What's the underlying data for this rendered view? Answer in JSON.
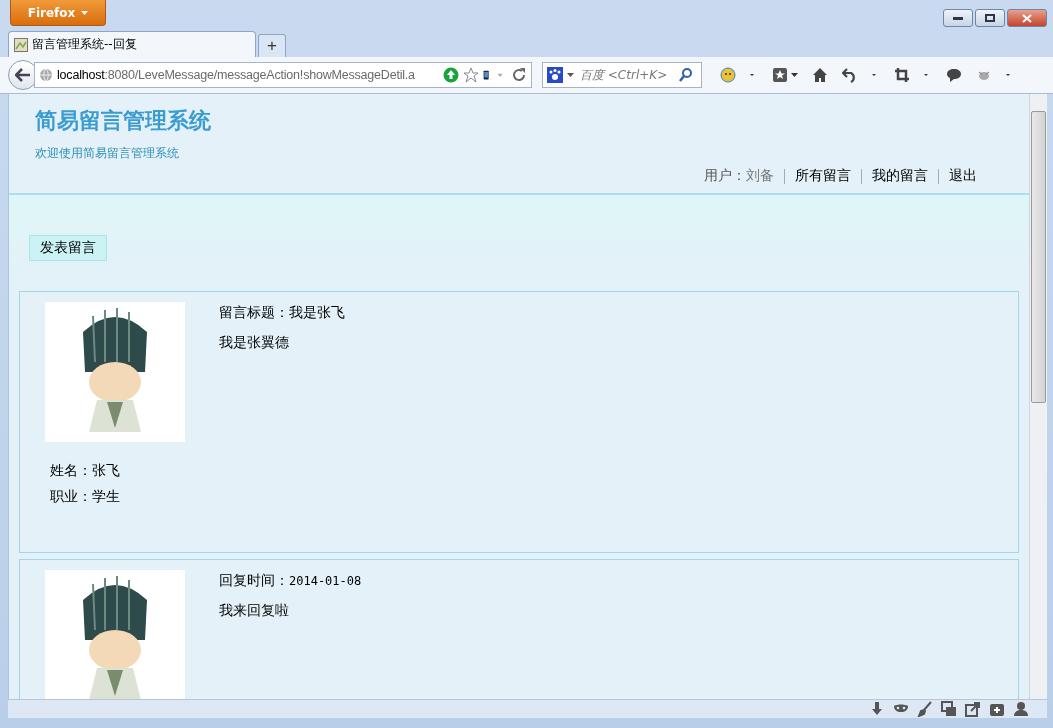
{
  "browser": {
    "app_button": "Firefox",
    "tabs": [
      {
        "title": "留言管理系统--回复",
        "selected": true
      }
    ],
    "new_tab": "+",
    "url_host": "localhost",
    "url_rest": ":8080/LeveMessage/messageAction!showMessageDetil.a",
    "search_placeholder": "百度 <Ctrl+K>"
  },
  "header": {
    "title": "简易留言管理系统",
    "subtitle": "欢迎使用简易留言管理系统",
    "user_label": "用户：",
    "user_name": "刘备",
    "links": [
      "所有留言",
      "我的留言",
      "退出"
    ]
  },
  "post_button": "发表留言",
  "cards": [
    {
      "kind": "message",
      "heading_label": "留言标题：",
      "heading_value": "我是张飞",
      "body": "我是张翼德",
      "details": [
        {
          "label": "姓名：",
          "value": "张飞"
        },
        {
          "label": "职业：",
          "value": "学生"
        }
      ]
    },
    {
      "kind": "reply",
      "heading_label": "回复时间：",
      "heading_value": "2014-01-08",
      "body": "我来回复啦"
    }
  ]
}
